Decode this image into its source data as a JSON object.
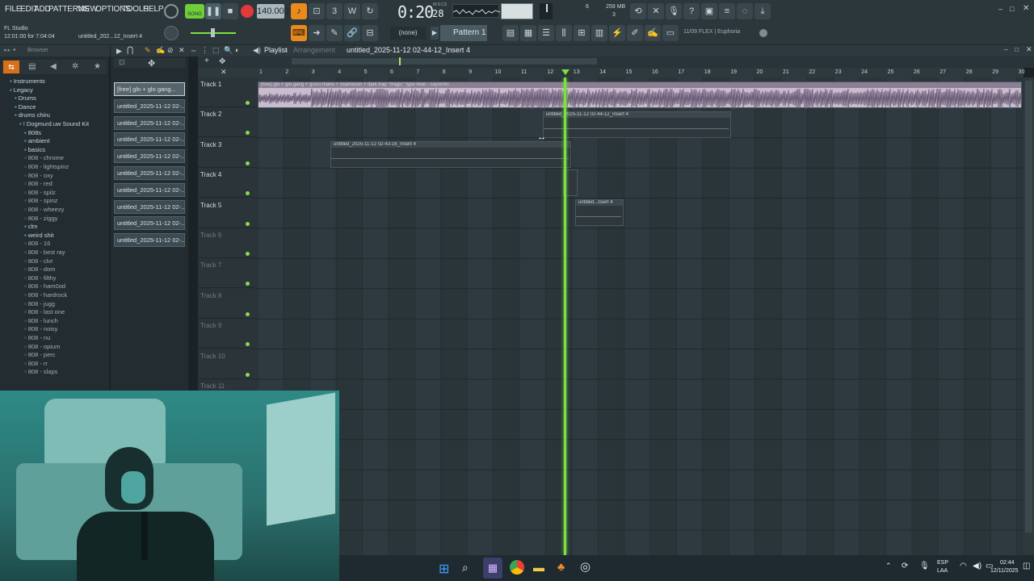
{
  "menu": [
    "FILE",
    "EDIT",
    "ADD",
    "PATTERNS",
    "VIEW",
    "OPTIONS",
    "TOOLS",
    "HELP"
  ],
  "transport": {
    "song_label": "SONG",
    "tempo": "140.000",
    "time": "0:20",
    "time_small": "28",
    "time_unit": "M:S:CS"
  },
  "status": {
    "app": "FL Studio",
    "time": "12:01:00 for 7:04:04",
    "project_short": "untitled_202...12_Insert 4",
    "cpu": "6",
    "mem": "259 MB",
    "voices": "3"
  },
  "toolbar2": {
    "snap": "(none)",
    "pattern": "Pattern 1",
    "news": "11/09  FLEX | Euphoria"
  },
  "browser": {
    "title": "Browser",
    "items": [
      {
        "label": "Instruments",
        "indent": 1,
        "folder": true
      },
      {
        "label": "Legacy",
        "indent": 1,
        "folder": true
      },
      {
        "label": "Drums",
        "indent": 2,
        "folder": true
      },
      {
        "label": "Dance",
        "indent": 2,
        "folder": true
      },
      {
        "label": "drums chiru",
        "indent": 2,
        "folder": true
      },
      {
        "label": "! Dogmurd.uw Sound Kit",
        "indent": 3,
        "folder": true
      },
      {
        "label": "808s",
        "indent": 4,
        "folder": true
      },
      {
        "label": "ambient",
        "indent": 4,
        "folder": true
      },
      {
        "label": "basics",
        "indent": 4,
        "folder": true
      },
      {
        "label": "808 - chrome",
        "indent": 4
      },
      {
        "label": "808 - lightspinz",
        "indent": 4
      },
      {
        "label": "808 - oxy",
        "indent": 4
      },
      {
        "label": "808 - red",
        "indent": 4
      },
      {
        "label": "808 - spilz",
        "indent": 4
      },
      {
        "label": "808 - spinz",
        "indent": 4
      },
      {
        "label": "808 - wheezy",
        "indent": 4
      },
      {
        "label": "808 - ziggy",
        "indent": 4
      },
      {
        "label": "clm",
        "indent": 4,
        "folder": true
      },
      {
        "label": "weird shit",
        "indent": 4,
        "folder": true
      },
      {
        "label": "808 - 16",
        "indent": 4
      },
      {
        "label": "808 - best ray",
        "indent": 4
      },
      {
        "label": "808 - clvr",
        "indent": 4
      },
      {
        "label": "808 - dom",
        "indent": 4
      },
      {
        "label": "808 - filthy",
        "indent": 4
      },
      {
        "label": "808 - ham0od",
        "indent": 4
      },
      {
        "label": "808 - hardrock",
        "indent": 4
      },
      {
        "label": "808 - jugg",
        "indent": 4
      },
      {
        "label": "808 - last one",
        "indent": 4
      },
      {
        "label": "808 - lunch",
        "indent": 4
      },
      {
        "label": "808 - noisy",
        "indent": 4
      },
      {
        "label": "808 - nu",
        "indent": 4
      },
      {
        "label": "808 - opium",
        "indent": 4
      },
      {
        "label": "808 - perc",
        "indent": 4
      },
      {
        "label": "808 - rr",
        "indent": 4
      },
      {
        "label": "808 - slaps",
        "indent": 4
      }
    ]
  },
  "patterns": [
    "[free] glo + glo gang...",
    "untitled_2025-11-12 02-...",
    "untitled_2025-11-12 02-...",
    "untitled_2025-11-12 02-...",
    "untitled_2025-11-12 02-...",
    "untitled_2025-11-12 02-...",
    "untitled_2025-11-12 02-...",
    "untitled_2025-11-12 02-...",
    "untitled_2025-11-12 02-...",
    "untitled_2025-11-12 02-..."
  ],
  "playlist": {
    "title": "Playlist",
    "crumb": "Arrangement",
    "file": "untitled_2025-11-12 02-44-12_Insert 4"
  },
  "tracks": [
    "Track 1",
    "Track 2",
    "Track 3",
    "Track 4",
    "Track 5",
    "Track 6",
    "Track 7",
    "Track 8",
    "Track 9",
    "Track 10",
    "Track 11"
  ],
  "ruler": [
    "1",
    "2",
    "3",
    "4",
    "5",
    "6",
    "7",
    "8",
    "9",
    "10",
    "11",
    "12",
    "13",
    "14",
    "15",
    "16",
    "17",
    "18",
    "19",
    "20",
    "21",
    "22",
    "23",
    "24",
    "25",
    "26",
    "27",
    "28",
    "29",
    "30"
  ],
  "clips": [
    {
      "label": "[free] glo + glo gang + gucci mane + osamason + dark trap \"magic\" type beat - saysxnts"
    },
    {
      "label": "untitled_2025-11-12 02-44-12_Insert 4"
    },
    {
      "label": "untitled_2025-11-12 02-43-16_Insert 4"
    },
    {
      "label": "untitled...nsert 4"
    }
  ],
  "taskbar": {
    "lang1": "ESP",
    "lang2": "LAA",
    "clock": "02:44",
    "date": "12/11/2025"
  }
}
